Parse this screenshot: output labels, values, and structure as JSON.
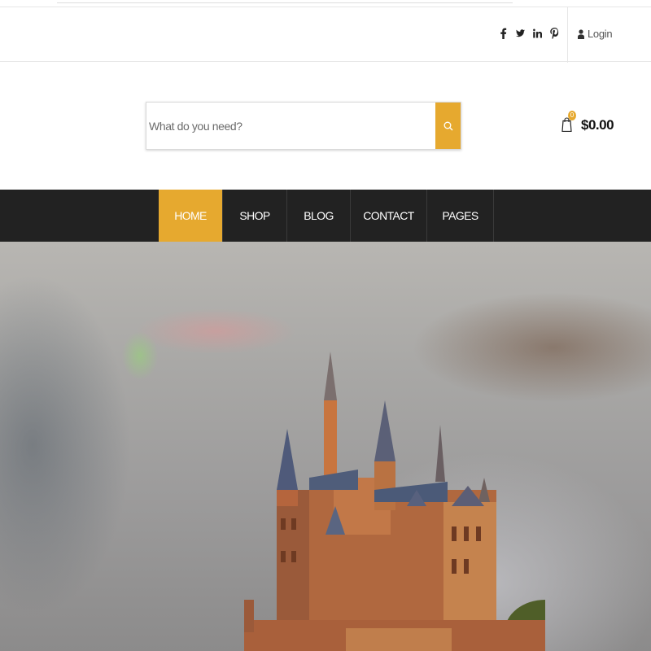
{
  "topbar": {
    "social_icons": [
      "facebook-icon",
      "twitter-icon",
      "linkedin-icon",
      "pinterest-icon"
    ],
    "login_label": "Login"
  },
  "search": {
    "placeholder": "What do you need?",
    "value": ""
  },
  "cart": {
    "count": "0",
    "total": "$0.00"
  },
  "nav": {
    "items": [
      {
        "label": "HOME",
        "active": true
      },
      {
        "label": "SHOP",
        "active": false
      },
      {
        "label": "BLOG",
        "active": false
      },
      {
        "label": "CONTACT",
        "active": false
      },
      {
        "label": "PAGES",
        "active": false
      }
    ]
  },
  "colors": {
    "accent": "#e6a92f",
    "navbar": "#222222"
  }
}
